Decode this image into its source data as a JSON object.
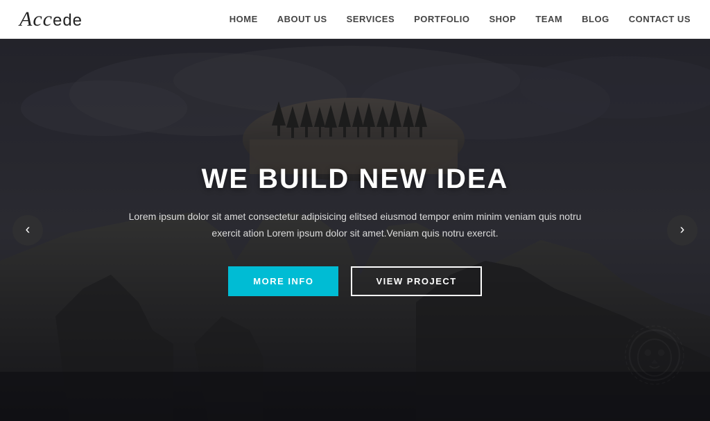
{
  "header": {
    "logo": "Accede",
    "logo_script": "Acc",
    "logo_rest": "ede",
    "nav": [
      {
        "label": "HOME",
        "id": "nav-home"
      },
      {
        "label": "ABOUT US",
        "id": "nav-about"
      },
      {
        "label": "SERVICES",
        "id": "nav-services"
      },
      {
        "label": "PORTFOLIO",
        "id": "nav-portfolio"
      },
      {
        "label": "SHOP",
        "id": "nav-shop"
      },
      {
        "label": "TEAM",
        "id": "nav-team"
      },
      {
        "label": "BLOG",
        "id": "nav-blog"
      },
      {
        "label": "CONTACT US",
        "id": "nav-contact"
      }
    ]
  },
  "hero": {
    "title": "WE BUILD NEW IDEA",
    "description": "Lorem ipsum dolor sit amet consectetur adipisicing elitsed eiusmod tempor enim minim veniam quis notru exercit ation Lorem ipsum dolor sit amet.Veniam quis notru exercit.",
    "btn_more": "MORE INFO",
    "btn_view": "VIEW PROJECT",
    "arrow_left": "‹",
    "arrow_right": "›"
  },
  "colors": {
    "accent": "#00bcd4",
    "header_bg": "#ffffff",
    "nav_text": "#444444",
    "hero_title": "#ffffff"
  }
}
